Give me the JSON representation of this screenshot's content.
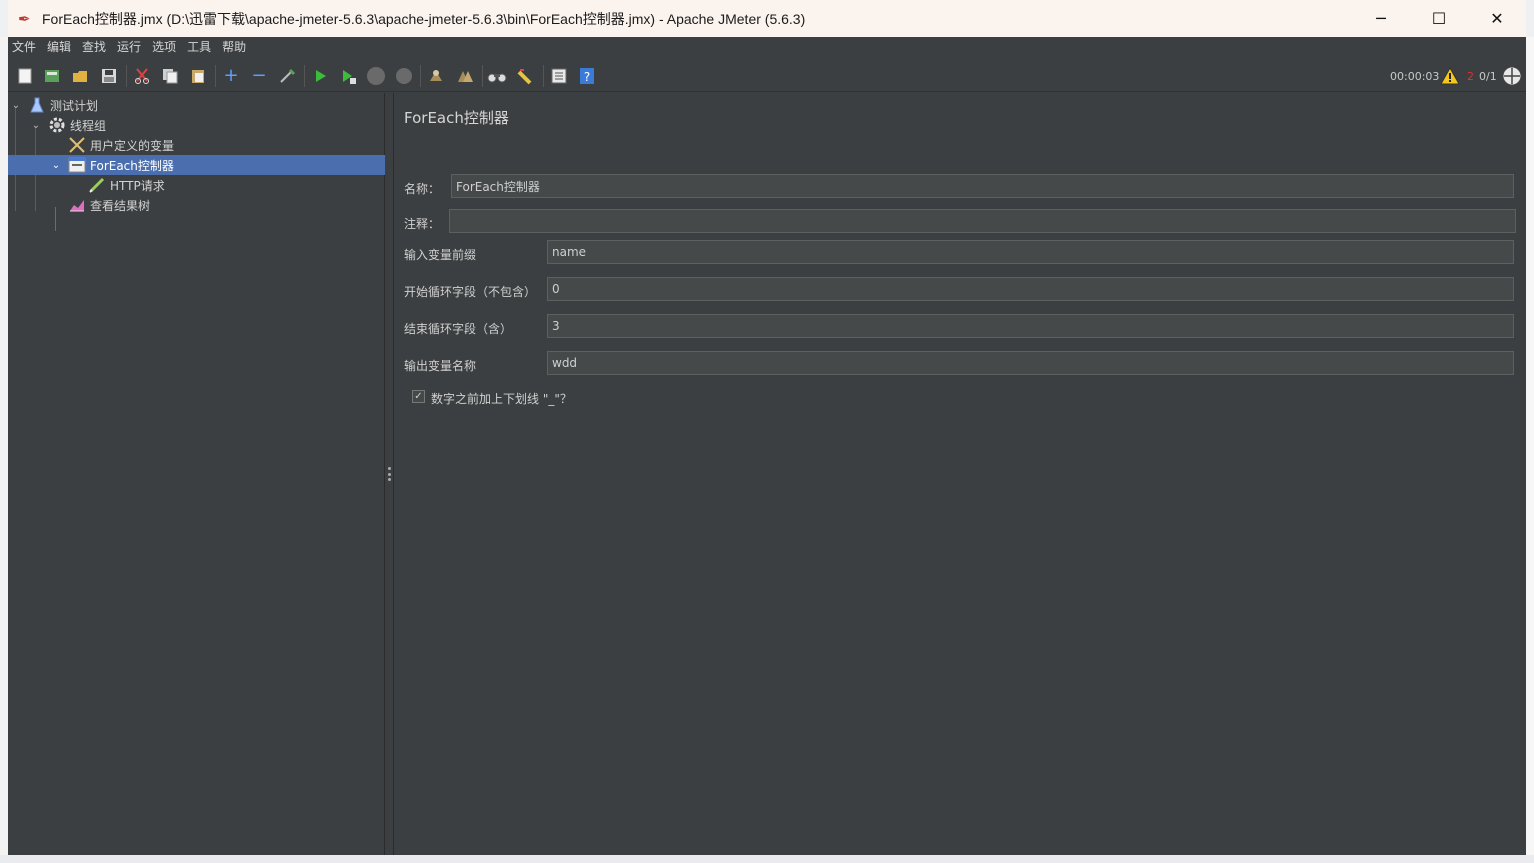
{
  "window": {
    "title": "ForEach控制器.jmx (D:\\迅雷下载\\apache-jmeter-5.6.3\\apache-jmeter-5.6.3\\bin\\ForEach控制器.jmx) - Apache JMeter (5.6.3)",
    "app_icon": "feather-pen-icon",
    "controls": {
      "minimize": "─",
      "maximize": "☐",
      "close": "✕"
    }
  },
  "menu": [
    "文件",
    "编辑",
    "查找",
    "运行",
    "选项",
    "工具",
    "帮助"
  ],
  "toolbar": {
    "icons": [
      "new-icon",
      "templates-icon",
      "open-icon",
      "save-icon",
      "cut-icon",
      "copy-icon",
      "paste-icon",
      "expand-icon",
      "collapse-icon",
      "toggle-icon",
      "start-icon",
      "start-no-pauses-icon",
      "stop-icon",
      "shutdown-icon",
      "clear-icon",
      "clear-all-icon",
      "search-icon",
      "reset-search-icon",
      "function-helper-icon",
      "help-icon"
    ],
    "elapsed_time": "00:00:03",
    "warning_count": "2",
    "thread_count": "0/1"
  },
  "tree": {
    "items": [
      {
        "label": "测试计划",
        "icon": "test-plan-icon",
        "expanded": true
      },
      {
        "label": "线程组",
        "icon": "gear-icon",
        "expanded": true
      },
      {
        "label": "用户定义的变量",
        "icon": "wrench-icon"
      },
      {
        "label": "ForEach控制器",
        "icon": "foreach-controller-icon",
        "expanded": true,
        "selected": true
      },
      {
        "label": "HTTP请求",
        "icon": "sampler-pen-icon"
      },
      {
        "label": "查看结果树",
        "icon": "chart-icon"
      }
    ]
  },
  "content": {
    "title": "ForEach控制器",
    "name_label": "名称：",
    "name_value": "ForEach控制器",
    "comment_label": "注释：",
    "comment_value": "",
    "input_prefix_label": "输入变量前缀",
    "input_prefix_value": "name",
    "start_index_label": "开始循环字段（不包含）",
    "start_index_value": "0",
    "end_index_label": "结束循环字段（含）",
    "end_index_value": "3",
    "output_var_label": "输出变量名称",
    "output_var_value": "wdd",
    "underscore_label": "数字之前加上下划线 \"_\"？",
    "underscore_checked": true
  },
  "colors": {
    "background": "#3c3f41",
    "selection": "#4b6eaf",
    "field": "#45494a",
    "titlebar": "#fbf3ee"
  }
}
